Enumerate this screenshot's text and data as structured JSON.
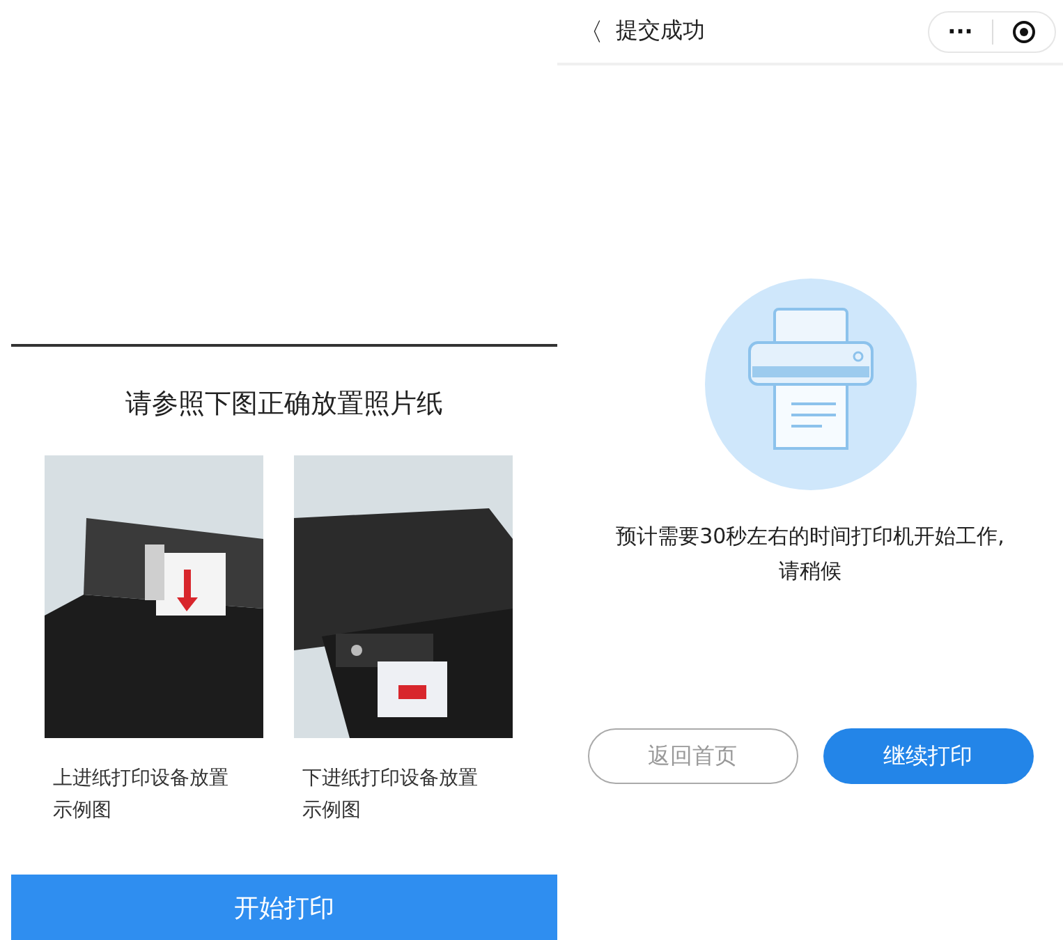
{
  "left_screen": {
    "heading": "请参照下图正确放置照片纸",
    "examples": [
      {
        "kind": "picture",
        "caption": "上进纸打印设备放置示例图"
      },
      {
        "kind": "picture",
        "caption": "下进纸打印设备放置示例图"
      }
    ],
    "start_button": "开始打印"
  },
  "right_screen": {
    "nav": {
      "back": "〈",
      "title": "提交成功",
      "more": "···"
    },
    "message": "预计需要30秒左右的时间打印机开始工作,请稍候",
    "buttons": [
      {
        "label": "返回首页",
        "kind": "outline"
      },
      {
        "label": "继续打印",
        "kind": "primary"
      }
    ]
  }
}
